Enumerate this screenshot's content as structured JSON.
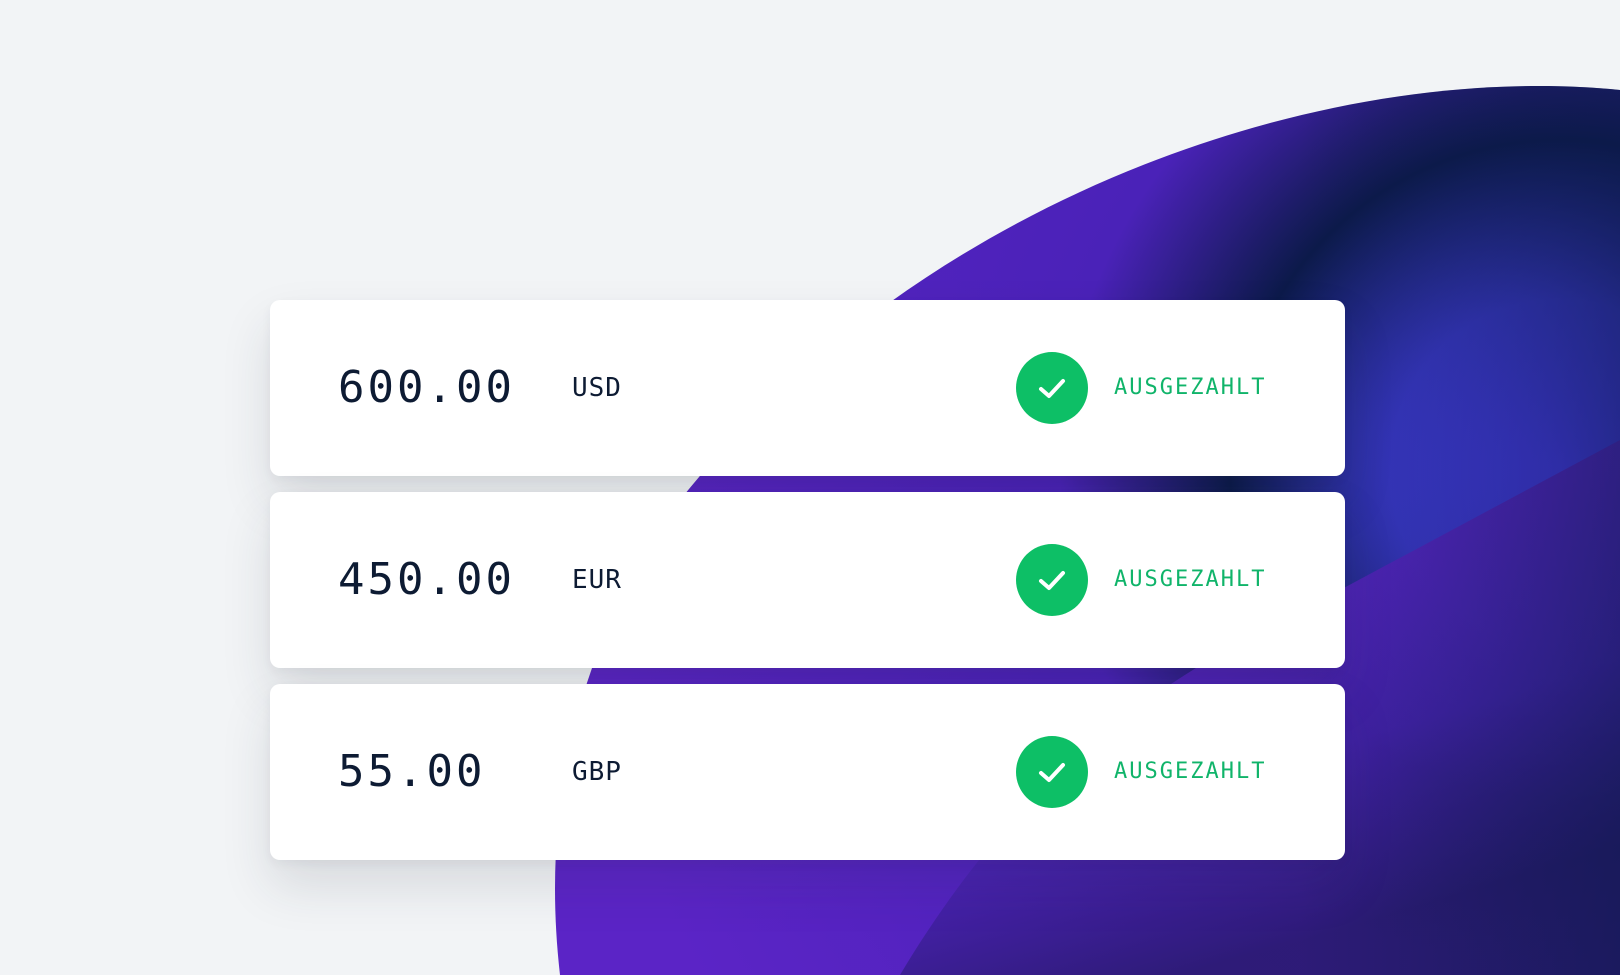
{
  "colors": {
    "background": "#f2f4f6",
    "card": "#ffffff",
    "text": "#0d1b33",
    "success": "#0dbf66",
    "success_text": "#10b46a",
    "accent_purple": "#5b22c8",
    "accent_navy": "#0c1a4a",
    "accent_blue": "#4a3cf0"
  },
  "payouts": [
    {
      "amount": "600.00",
      "currency": "USD",
      "status": "AUSGEZAHLT",
      "status_icon": "check-icon"
    },
    {
      "amount": "450.00",
      "currency": "EUR",
      "status": "AUSGEZAHLT",
      "status_icon": "check-icon"
    },
    {
      "amount": "55.00",
      "currency": "GBP",
      "status": "AUSGEZAHLT",
      "status_icon": "check-icon"
    }
  ]
}
